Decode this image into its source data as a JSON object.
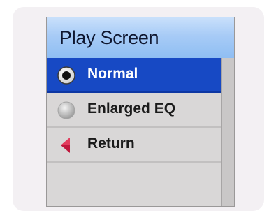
{
  "screen": {
    "title": "Play Screen"
  },
  "menu": {
    "items": [
      {
        "label": "Normal",
        "icon": "radio-selected-icon",
        "selected": true
      },
      {
        "label": "Enlarged EQ",
        "icon": "radio-unselected-icon",
        "selected": false
      },
      {
        "label": "Return",
        "icon": "back-arrow-icon",
        "selected": false
      }
    ]
  },
  "colors": {
    "selection": "#1749c4",
    "title_bar": "#a7cbf6",
    "menu_background": "#d9d7d7",
    "return_arrow": "#c0173c"
  }
}
